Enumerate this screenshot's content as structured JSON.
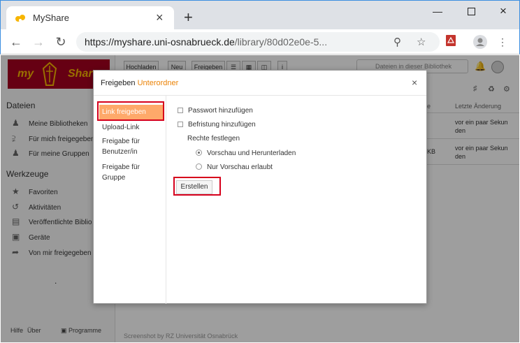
{
  "browser": {
    "tab_title": "MyShare",
    "new_tab": "+",
    "url_host": "https://myshare.uni-osnabrueck.de",
    "url_path": "/library/80d02e0e-5..."
  },
  "page": {
    "logo_left": "my",
    "logo_right": "Shar",
    "sidebar": {
      "files_heading": "Dateien",
      "files_items": [
        {
          "label": "Meine Bibliotheken",
          "icon": "user-icon"
        },
        {
          "label": "Für mich freigegeben",
          "icon": "share-icon"
        },
        {
          "label": "Für meine Gruppen",
          "icon": "group-icon"
        }
      ],
      "tools_heading": "Werkzeuge",
      "tools_items": [
        {
          "label": "Favoriten",
          "icon": "star-icon"
        },
        {
          "label": "Aktivitäten",
          "icon": "history-icon"
        },
        {
          "label": "Veröffentlichte Biblio",
          "icon": "book-icon"
        },
        {
          "label": "Geräte",
          "icon": "monitor-icon"
        },
        {
          "label": "Von mir freigegeben",
          "icon": "share-out-icon"
        }
      ],
      "dot": ".",
      "footer": {
        "help": "Hilfe",
        "about": "Über",
        "programs": "Programme"
      }
    },
    "toolbar": {
      "upload": "Hochladen",
      "new": "Neu",
      "share": "Freigeben"
    },
    "search_placeholder": "Dateien in dieser Bibliothek",
    "table": {
      "col_size_fragment": "e",
      "col_modified": "Letzte Änderung",
      "rows": [
        {
          "size": "",
          "modified_1": "vor ein paar Sekun",
          "modified_2": "den"
        },
        {
          "size": "KB",
          "modified_1": "vor ein paar Sekun",
          "modified_2": "den"
        }
      ]
    },
    "footer_note": "Screenshot by RZ Universität Osnabrück"
  },
  "modal": {
    "title_prefix": "Freigeben",
    "title_accent": "Unterordner",
    "nav": [
      {
        "label": "Link freigeben",
        "active": true
      },
      {
        "label": "Upload-Link",
        "active": false
      },
      {
        "label": "Freigabe für Benutzer/in",
        "active": false
      },
      {
        "label": "Freigabe für Gruppe",
        "active": false
      }
    ],
    "options": {
      "password": "Passwort hinzufügen",
      "expiry": "Befristung hinzufügen",
      "rights_label": "Rechte festlegen",
      "radio_download": "Vorschau und Herunterladen",
      "radio_preview": "Nur Vorschau erlaubt"
    },
    "create_button": "Erstellen"
  },
  "colors": {
    "accent": "#eb8205",
    "highlight": "#d6001c",
    "active_tab": "#fea96a",
    "brand": "#a5001f"
  }
}
